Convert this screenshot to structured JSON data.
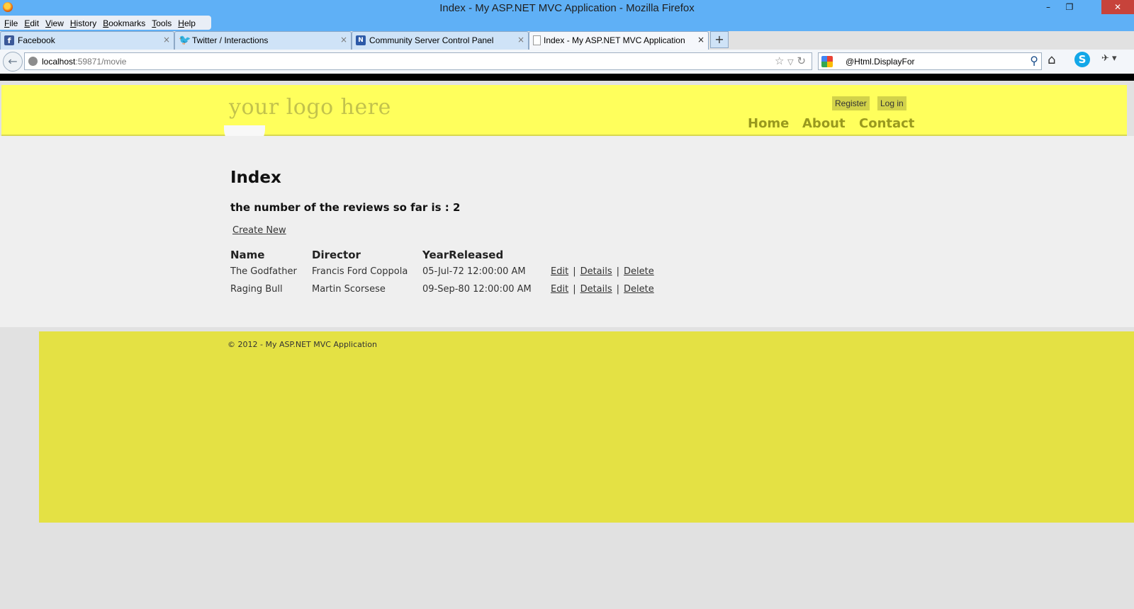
{
  "window": {
    "title": "Index - My ASP.NET MVC Application - Mozilla Firefox",
    "minimize": "–",
    "restore": "❐",
    "close": "✕"
  },
  "menu": [
    "File",
    "Edit",
    "View",
    "History",
    "Bookmarks",
    "Tools",
    "Help"
  ],
  "tabs": [
    {
      "label": "Facebook",
      "icon": "facebook-icon",
      "close": "×"
    },
    {
      "label": "Twitter / Interactions",
      "icon": "twitter-icon",
      "close": "×"
    },
    {
      "label": "Community Server Control Panel",
      "icon": "community-server-icon",
      "close": "×"
    },
    {
      "label": "Index - My ASP.NET MVC Application",
      "icon": "page-icon",
      "close": "×"
    }
  ],
  "new_tab": "+",
  "navbar": {
    "url_host": "localhost",
    "url_rest": ":59871/movie",
    "search_value": "@Html.DisplayFor"
  },
  "site": {
    "logo": "your logo here",
    "register": "Register",
    "login": "Log in",
    "nav": [
      "Home",
      "About",
      "Contact"
    ]
  },
  "main": {
    "heading": "Index",
    "review_count_text": "the number of the reviews so far is : 2",
    "create_new": "Create New",
    "columns": [
      "Name",
      "Director",
      "YearReleased"
    ],
    "rows": [
      {
        "name": "The Godfather",
        "director": "Francis Ford Coppola",
        "year": "05-Jul-72 12:00:00 AM",
        "edit": "Edit",
        "details": "Details",
        "delete": "Delete"
      },
      {
        "name": "Raging Bull",
        "director": "Martin Scorsese",
        "year": "09-Sep-80 12:00:00 AM",
        "edit": "Edit",
        "details": "Details",
        "delete": "Delete"
      }
    ],
    "separator": "|"
  },
  "footer": {
    "text": "© 2012 - My ASP.NET MVC Application"
  },
  "colors": {
    "titlebar": "#5fb0f6",
    "header": "#ffff5c",
    "footer": "#e4e144",
    "nav_text": "#99991e"
  }
}
